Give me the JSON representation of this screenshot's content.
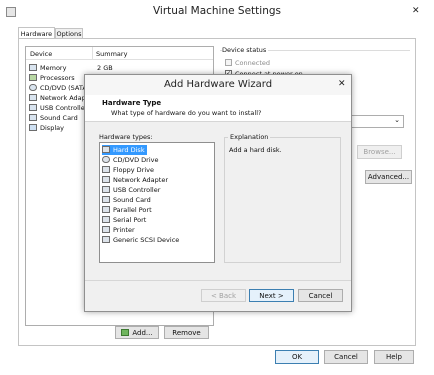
{
  "vm": {
    "title": "Virtual Machine Settings",
    "tabs": [
      {
        "label": "Hardware"
      },
      {
        "label": "Options"
      }
    ],
    "device_header": "Device",
    "summary_header": "Summary",
    "devices": [
      {
        "name": "Memory",
        "icon": "memory-icon"
      },
      {
        "name": "Processors",
        "icon": "processor-icon"
      },
      {
        "name": "CD/DVD (SATA",
        "icon": "cd-dvd-icon"
      },
      {
        "name": "Network Adap",
        "icon": "network-adapter-icon"
      },
      {
        "name": "USB Controller",
        "icon": "usb-icon"
      },
      {
        "name": "Sound Card",
        "icon": "sound-card-icon"
      },
      {
        "name": "Display",
        "icon": "display-icon"
      }
    ],
    "memory_summary": "2 GB",
    "device_status_title": "Device status",
    "connected_label": "Connected",
    "connect_power_label": "Connect at power on",
    "browse_label": "Browse...",
    "advanced_label": "Advanced...",
    "add_label": "Add...",
    "remove_label": "Remove",
    "ok_label": "OK",
    "cancel_label": "Cancel",
    "help_label": "Help"
  },
  "wizard": {
    "title": "Add Hardware Wizard",
    "heading": "Hardware Type",
    "subheading": "What type of hardware do you want to install?",
    "types_label": "Hardware types:",
    "types": [
      {
        "name": "Hard Disk",
        "icon": "hard-disk-icon",
        "selected": true
      },
      {
        "name": "CD/DVD Drive",
        "icon": "cd-dvd-drive-icon"
      },
      {
        "name": "Floppy Drive",
        "icon": "floppy-drive-icon"
      },
      {
        "name": "Network Adapter",
        "icon": "network-adapter-icon"
      },
      {
        "name": "USB Controller",
        "icon": "usb-controller-icon"
      },
      {
        "name": "Sound Card",
        "icon": "sound-card-icon"
      },
      {
        "name": "Parallel Port",
        "icon": "parallel-port-icon"
      },
      {
        "name": "Serial Port",
        "icon": "serial-port-icon"
      },
      {
        "name": "Printer",
        "icon": "printer-icon"
      },
      {
        "name": "Generic SCSI Device",
        "icon": "scsi-device-icon"
      }
    ],
    "explanation_label": "Explanation",
    "explanation_text": "Add a hard disk.",
    "back_label": "< Back",
    "next_label": "Next >",
    "cancel_label": "Cancel"
  },
  "colors": {
    "accent": "#3399ff",
    "window_bg": "#ffffff",
    "panel_bg": "#f0f0f0",
    "header_bg": "#ffffff"
  }
}
